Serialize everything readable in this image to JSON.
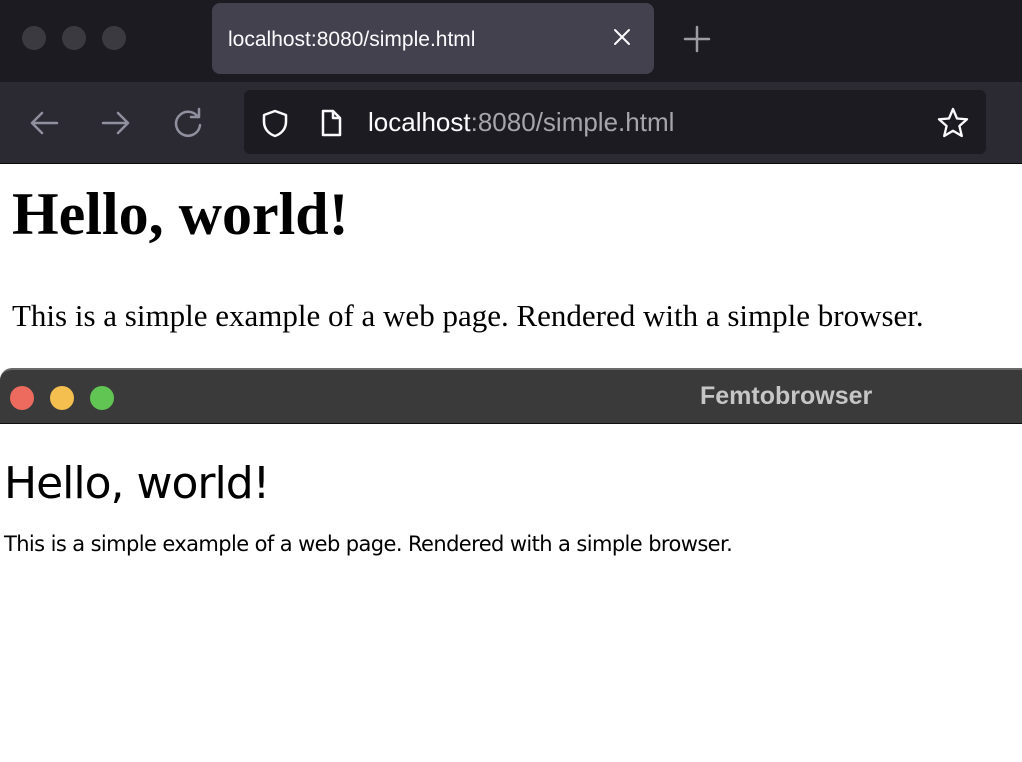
{
  "firefox": {
    "tab": {
      "title": "localhost:8080/simple.html",
      "close_icon": "close-icon"
    },
    "new_tab_icon": "plus-icon",
    "nav": {
      "back_icon": "back-arrow-icon",
      "forward_icon": "forward-arrow-icon",
      "reload_icon": "reload-icon"
    },
    "url": {
      "host": "localhost",
      "rest": ":8080/simple.html"
    },
    "page": {
      "heading": "Hello, world!",
      "paragraph": "This is a simple example of a web page. Rendered with a simple browser."
    },
    "colors": {
      "tabbar": "#1c1b22",
      "tab": "#42414d",
      "navbar": "#2b2a33",
      "urlbar": "#1c1b22"
    }
  },
  "femtobrowser": {
    "title": "Femtobrowser",
    "page": {
      "heading": "Hello, world!",
      "paragraph": "This is a simple example of a web page. Rendered with a simple browser."
    },
    "colors": {
      "close": "#ed6a5e",
      "minimize": "#f5bf4f",
      "zoom": "#61c554",
      "titlebar": "#3a3a3a"
    }
  }
}
